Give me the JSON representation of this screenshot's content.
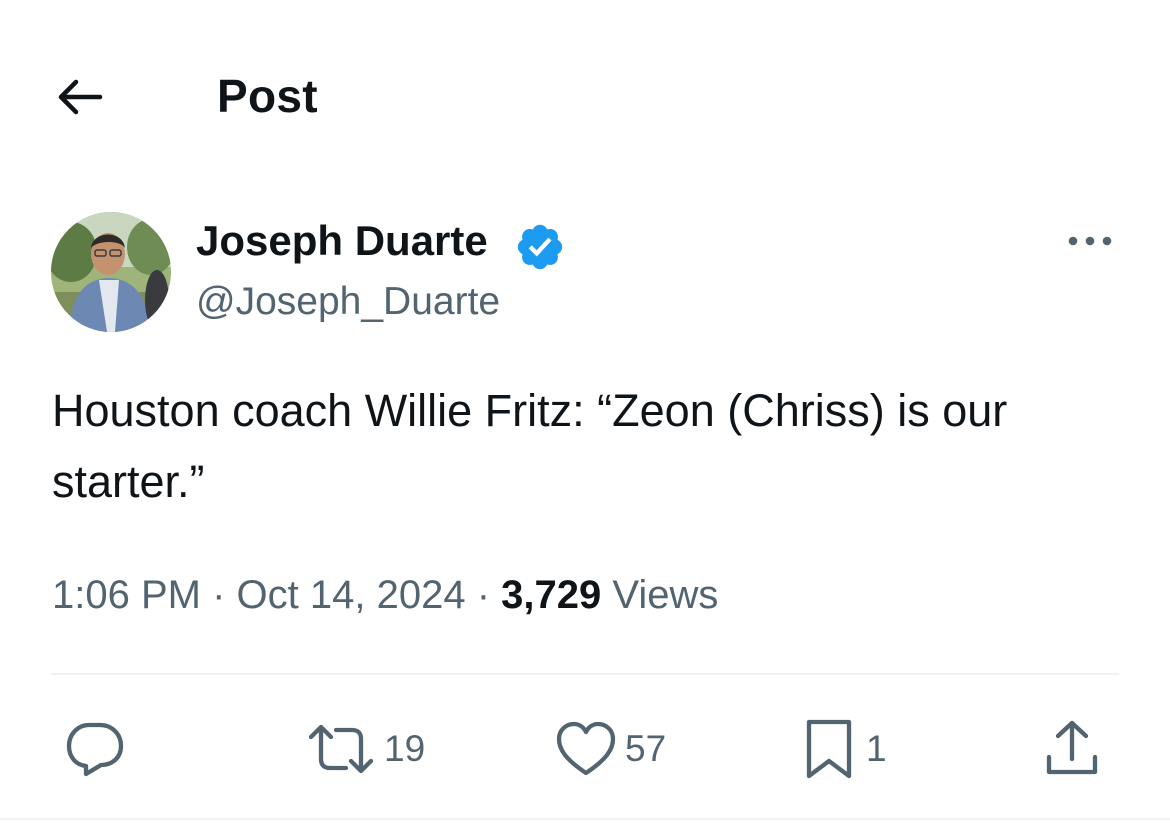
{
  "header": {
    "back_icon": "arrow-left-icon",
    "title": "Post"
  },
  "author": {
    "display_name": "Joseph Duarte",
    "handle": "@Joseph_Duarte",
    "verified_icon": "verified-badge-icon",
    "verified_color": "#1d9bf0",
    "more_icon": "more-horizontal-icon"
  },
  "tweet": {
    "text": "Houston coach Willie Fritz: “Zeon (Chriss) is our starter.”",
    "time": "1:06 PM",
    "separator": "·",
    "date": "Oct 14, 2024",
    "views_count": "3,729",
    "views_label": "Views"
  },
  "actions": {
    "reply": {
      "icon": "reply-icon",
      "count": ""
    },
    "repost": {
      "icon": "repost-icon",
      "count": "19"
    },
    "like": {
      "icon": "heart-icon",
      "count": "57"
    },
    "bookmark": {
      "icon": "bookmark-icon",
      "count": "1"
    },
    "share": {
      "icon": "share-icon",
      "count": ""
    }
  },
  "colors": {
    "text_primary": "#0f1419",
    "text_secondary": "#536471",
    "divider": "#eff3f4",
    "accent": "#1d9bf0"
  }
}
